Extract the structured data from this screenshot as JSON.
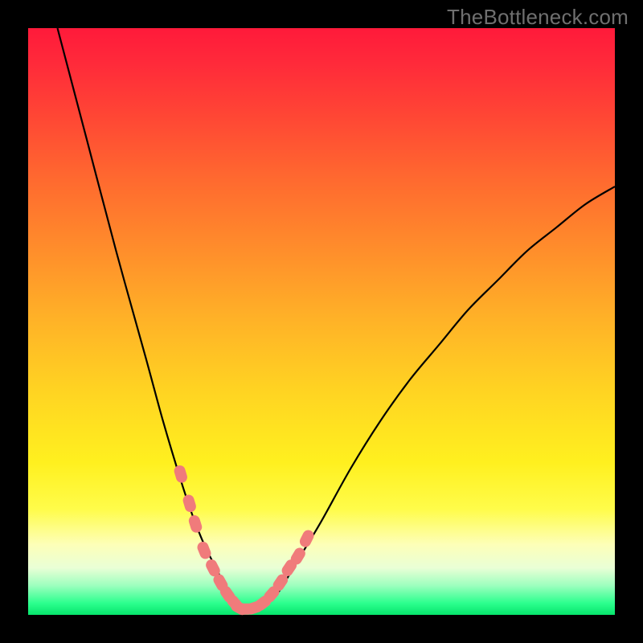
{
  "watermark": "TheBottleneck.com",
  "colors": {
    "background": "#000000",
    "gradient_top": "#ff1a3a",
    "gradient_bottom": "#07e56c",
    "curve": "#000000",
    "markers": "#f07b7b"
  },
  "chart_data": {
    "type": "line",
    "title": "",
    "xlabel": "",
    "ylabel": "",
    "xlim": [
      0,
      100
    ],
    "ylim": [
      0,
      100
    ],
    "grid": false,
    "legend": false,
    "series": [
      {
        "name": "bottleneck-curve",
        "x": [
          5,
          10,
          15,
          20,
          23,
          26,
          28,
          30,
          32,
          33,
          34,
          35,
          36,
          37,
          38,
          40,
          42,
          44,
          47,
          50,
          55,
          60,
          65,
          70,
          75,
          80,
          85,
          90,
          95,
          100
        ],
        "values": [
          100,
          81,
          62,
          44,
          33,
          23,
          17,
          12,
          8,
          6,
          4,
          2.5,
          1.5,
          1,
          1,
          1.5,
          3,
          6,
          11,
          16,
          25,
          33,
          40,
          46,
          52,
          57,
          62,
          66,
          70,
          73
        ]
      }
    ],
    "markers": {
      "name": "highlighted-points",
      "x": [
        26.0,
        27.5,
        28.5,
        30.0,
        31.5,
        32.8,
        34.0,
        35.2,
        36.0,
        37.0,
        38.5,
        40.0,
        41.5,
        43.0,
        44.5,
        46.0,
        47.5
      ],
      "values": [
        24.0,
        19.0,
        15.5,
        11.0,
        8.0,
        5.5,
        3.5,
        2.0,
        1.2,
        1.0,
        1.2,
        2.0,
        3.5,
        5.5,
        8.0,
        10.0,
        13.0
      ]
    }
  }
}
